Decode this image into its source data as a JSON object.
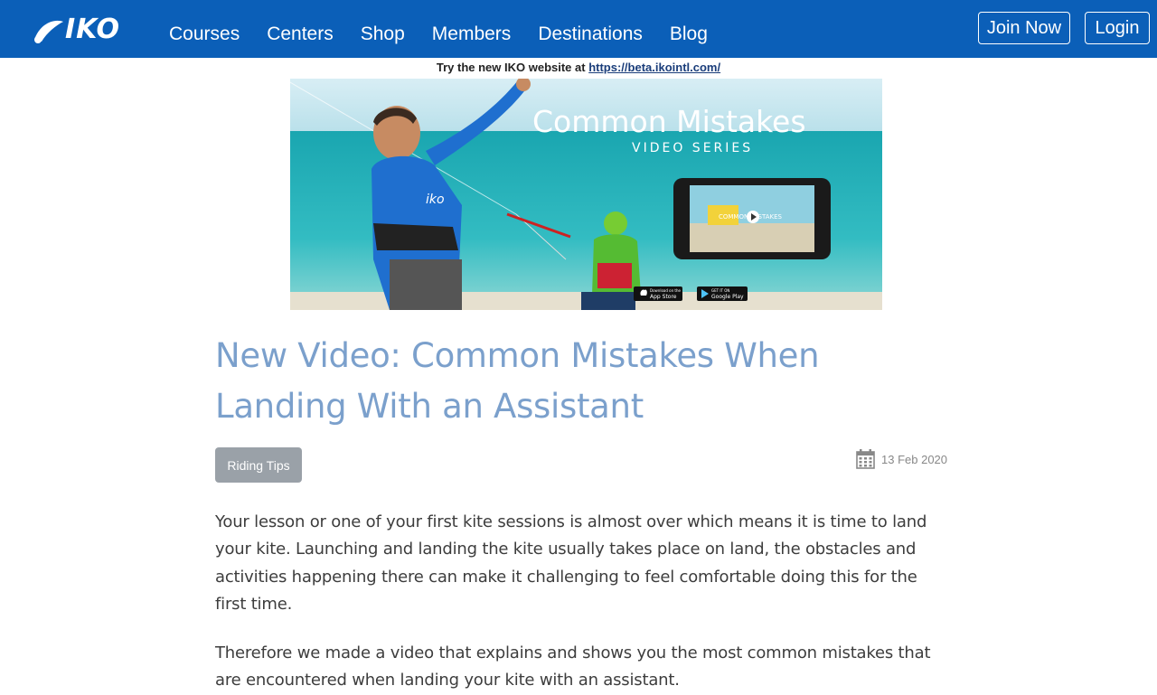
{
  "header": {
    "logo_text": "IKO",
    "nav": [
      "Courses",
      "Centers",
      "Shop",
      "Members",
      "Destinations",
      "Blog"
    ],
    "join_label": "Join Now",
    "login_label": "Login"
  },
  "notice": {
    "text": "Try the new IKO website at ",
    "link": "https://beta.ikointl.com/"
  },
  "hero": {
    "headline": "Common Mistakes",
    "subheadline": "VIDEO SERIES",
    "phone_text": "COMMON MISTAKES",
    "app_store": "App Store",
    "app_store_small": "Download on the",
    "google_play": "Google Play",
    "google_play_small": "GET IT ON",
    "shirt_text": "iko"
  },
  "post": {
    "title": "New Video: Common Mistakes When Landing With an Assistant",
    "tag": "Riding Tips",
    "date": "13 Feb 2020",
    "paragraphs": [
      "Your lesson or one of your first kite sessions is almost over which means it is time to land your kite. Launching and landing the kite usually takes place on land, the obstacles and activities happening there can make it challenging to feel comfortable doing this for the first time.",
      "Therefore we made a video that explains and shows you the most common mistakes that are encountered when landing your kite with an assistant."
    ]
  },
  "colors": {
    "nav_bg": "#0b5fb8",
    "title": "#7ba0cc",
    "tag_bg": "#9aa1a8"
  }
}
